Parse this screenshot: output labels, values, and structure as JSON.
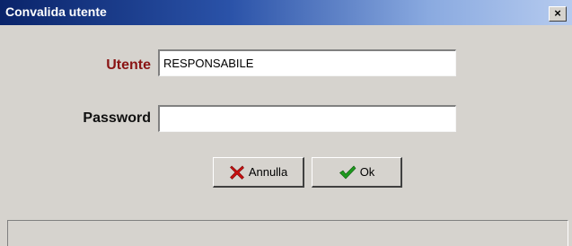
{
  "window": {
    "title": "Convalida utente",
    "close_glyph": "×"
  },
  "form": {
    "user_label": "Utente",
    "user_value": "RESPONSABILE",
    "password_label": "Password",
    "password_value": ""
  },
  "buttons": {
    "cancel_label": "Annulla",
    "cancel_icon": "x-cross-icon",
    "ok_label": "Ok",
    "ok_icon": "checkmark-icon"
  },
  "colors": {
    "title_bar_start": "#0a246a",
    "title_bar_end": "#b6cbef",
    "user_label": "#8a1414",
    "cancel_icon": "#c81010",
    "ok_icon": "#1e9a1e"
  }
}
